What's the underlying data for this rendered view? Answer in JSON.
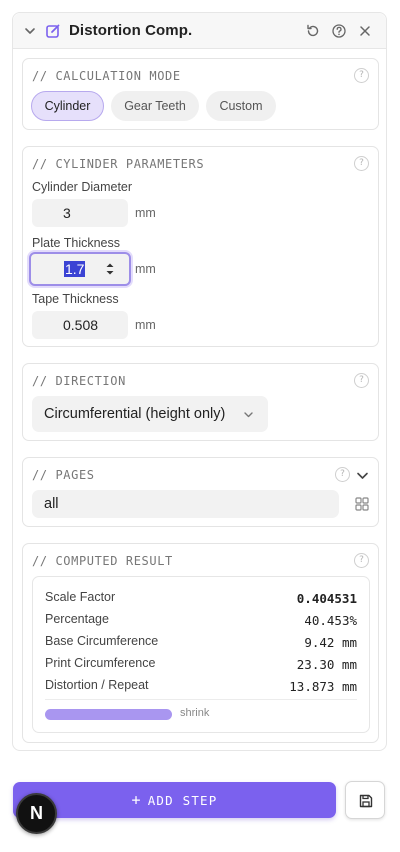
{
  "panel": {
    "title": "Distortion Comp."
  },
  "calculation_mode": {
    "title": "// CALCULATION MODE",
    "options": [
      "Cylinder",
      "Gear Teeth",
      "Custom"
    ],
    "selected": "Cylinder"
  },
  "cylinder_parameters": {
    "title": "// CYLINDER PARAMETERS",
    "cylinder_diameter": {
      "label": "Cylinder Diameter",
      "value": "3",
      "unit": "mm"
    },
    "plate_thickness": {
      "label": "Plate Thickness",
      "value": "1.7",
      "unit": "mm"
    },
    "tape_thickness": {
      "label": "Tape Thickness",
      "value": "0.508",
      "unit": "mm"
    }
  },
  "direction": {
    "title": "// DIRECTION",
    "selected": "Circumferential (height only)"
  },
  "pages": {
    "title": "// PAGES",
    "value": "all"
  },
  "computed_result": {
    "title": "// COMPUTED RESULT",
    "rows": [
      {
        "label": "Scale Factor",
        "value": "0.404531"
      },
      {
        "label": "Percentage",
        "value": "40.453%"
      },
      {
        "label": "Base Circumference",
        "value": "9.42 mm"
      },
      {
        "label": "Print Circumference",
        "value": "23.30 mm"
      },
      {
        "label": "Distortion / Repeat",
        "value": "13.873 mm"
      }
    ],
    "bar_label": "shrink",
    "bar_fraction": 0.4
  },
  "actions": {
    "add_step": "ADD STEP"
  },
  "avatar": {
    "initial": "N"
  },
  "colors": {
    "accent": "#7b61ee",
    "accent_light": "#e6e0fb",
    "bar": "#a996f0"
  }
}
